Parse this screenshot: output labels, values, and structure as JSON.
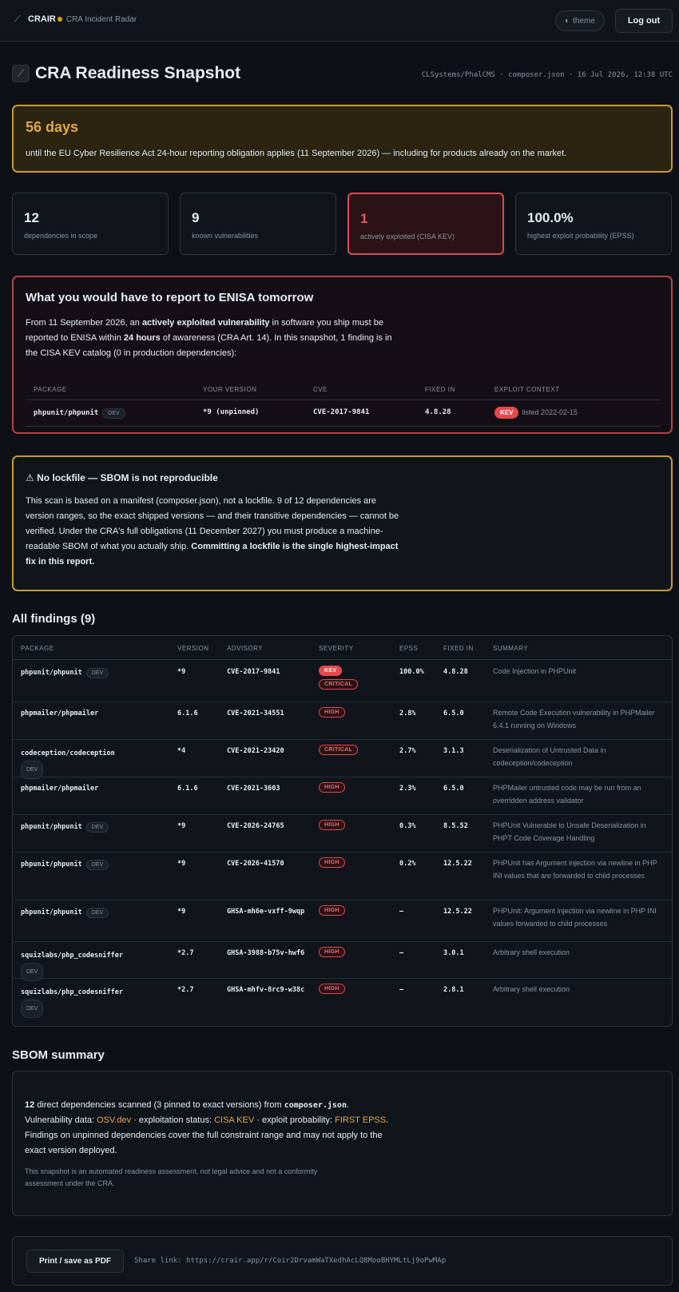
{
  "topbar": {
    "brand_name": "CRAIR",
    "brand_subtitle": "CRA Incident Radar",
    "theme_label": "theme",
    "logout_label": "Log out"
  },
  "header": {
    "title": "CRA Readiness Snapshot",
    "meta": "CLSystems/PhalCMS · composer.json · 16 Jul 2026, 12:38 UTC"
  },
  "countdown": {
    "days": "56 days",
    "text": "until the EU Cyber Resilience Act 24-hour reporting obligation applies (11 September 2026) — including for products already on the market."
  },
  "stats": [
    {
      "value": "12",
      "label": "dependencies in scope"
    },
    {
      "value": "9",
      "label": "known vulnerabilities"
    },
    {
      "value": "1",
      "label": "actively exploited (CISA KEV)"
    },
    {
      "value": "100.0%",
      "label": "highest exploit probability (EPSS)"
    }
  ],
  "report": {
    "title": "What you would have to report to ENISA tomorrow",
    "body_1": "From 11 September 2026, an ",
    "body_bold_1": "actively exploited vulnerability",
    "body_2": " in software you ship must be reported to ENISA within ",
    "body_bold_2": "24 hours",
    "body_3": " of awareness (CRA Art. 14). In this snapshot, 1 finding is in the CISA KEV catalog (0 in production dependencies):",
    "columns": [
      "PACKAGE",
      "YOUR VERSION",
      "CVE",
      "FIXED IN",
      "EXPLOIT CONTEXT"
    ],
    "row": {
      "package": "phpunit/phpunit",
      "dev": "DEV",
      "version": "*9 (unpinned)",
      "cve": "CVE-2017-9841",
      "fixed": "4.8.28",
      "kev": "KEV",
      "listed": "listed 2022-02-15"
    }
  },
  "warning": {
    "title": "No lockfile — SBOM is not reproducible",
    "body": "This scan is based on a manifest (composer.json), not a lockfile. 9 of 12 dependencies are version ranges, so the exact shipped versions — and their transitive dependencies — cannot be verified. Under the CRA's full obligations (11 December 2027) you must produce a machine-readable SBOM of what you actually ship. ",
    "body_bold": "Committing a lockfile is the single highest-impact fix in this report."
  },
  "findings": {
    "title": "All findings (9)",
    "columns": [
      "PACKAGE",
      "VERSION",
      "ADVISORY",
      "SEVERITY",
      "EPSS",
      "FIXED IN",
      "SUMMARY"
    ],
    "rows": [
      {
        "package": "phpunit/phpunit",
        "dev": "DEV",
        "version": "*9",
        "advisory": "CVE-2017-9841",
        "kev": "KEV",
        "severity": "CRITICAL",
        "epss": "100.0%",
        "fixed": "4.8.28",
        "summary": "Code Injection in PHPUnit"
      },
      {
        "package": "phpmailer/phpmailer",
        "dev": "",
        "version": "6.1.6",
        "advisory": "CVE-2021-34551",
        "kev": "",
        "severity": "HIGH",
        "epss": "2.8%",
        "fixed": "6.5.0",
        "summary": "Remote Code Execution vulnerability in PHPMailer 6.4.1 running on Windows"
      },
      {
        "package": "codeception/codeception",
        "dev": "DEV",
        "version": "*4",
        "advisory": "CVE-2021-23420",
        "kev": "",
        "severity": "CRITICAL",
        "epss": "2.7%",
        "fixed": "3.1.3",
        "summary": "Deserialization of Untrusted Data in codeception/codeception"
      },
      {
        "package": "phpmailer/phpmailer",
        "dev": "",
        "version": "6.1.6",
        "advisory": "CVE-2021-3603",
        "kev": "",
        "severity": "HIGH",
        "epss": "2.3%",
        "fixed": "6.5.0",
        "summary": "PHPMailer untrusted code may be run from an overridden address validator"
      },
      {
        "package": "phpunit/phpunit",
        "dev": "DEV",
        "version": "*9",
        "advisory": "CVE-2026-24765",
        "kev": "",
        "severity": "HIGH",
        "epss": "0.3%",
        "fixed": "8.5.52",
        "summary": "PHPUnit Vulnerable to Unsafe Deserialization in PHPT Code Coverage Handling"
      },
      {
        "package": "phpunit/phpunit",
        "dev": "DEV",
        "version": "*9",
        "advisory": "CVE-2026-41570",
        "kev": "",
        "severity": "HIGH",
        "epss": "0.2%",
        "fixed": "12.5.22",
        "summary": "PHPUnit has Argument injection via newline in PHP INI values that are forwarded to child processes"
      },
      {
        "package": "phpunit/phpunit",
        "dev": "DEV",
        "version": "*9",
        "advisory": "GHSA-mh6e-vxff-9wqp",
        "kev": "",
        "severity": "HIGH",
        "epss": "–",
        "fixed": "12.5.22",
        "summary": "PHPUnit: Argument injection via newline in PHP INI values forwarded to child processes"
      },
      {
        "package": "squizlabs/php_codesniffer",
        "dev": "DEV",
        "version": "*2.7",
        "advisory": "GHSA-3988-b75v-hwf6",
        "kev": "",
        "severity": "HIGH",
        "epss": "–",
        "fixed": "3.0.1",
        "summary": "Arbitrary shell execution"
      },
      {
        "package": "squizlabs/php_codesniffer",
        "dev": "DEV",
        "version": "*2.7",
        "advisory": "GHSA-mhfv-8rc9-w38c",
        "kev": "",
        "severity": "HIGH",
        "epss": "–",
        "fixed": "2.8.1",
        "summary": "Arbitrary shell execution"
      }
    ]
  },
  "sbom": {
    "title": "SBOM summary",
    "count": "12",
    "text_1": " direct dependencies scanned (3 pinned to exact versions) from ",
    "file": "composer.json",
    "text_2": ". Vulnerability data: ",
    "osv": "OSV.dev",
    "text_3": " · exploitation status: ",
    "kev": "CISA KEV",
    "text_4": " · exploit probability: ",
    "epss": "FIRST EPSS",
    "text_5": ". Findings on unpinned dependencies cover the full constraint range and may not apply to the exact version deployed.",
    "disclaimer": "This snapshot is an automated readiness assessment, not legal advice and not a conformity assessment under the CRA."
  },
  "print": {
    "button": "Print / save as PDF",
    "share": "Share link: https://crair.app/r/Coir2DrvamWaTXedhAcLQ8MooBHYMLtLj9oPwMAp"
  }
}
